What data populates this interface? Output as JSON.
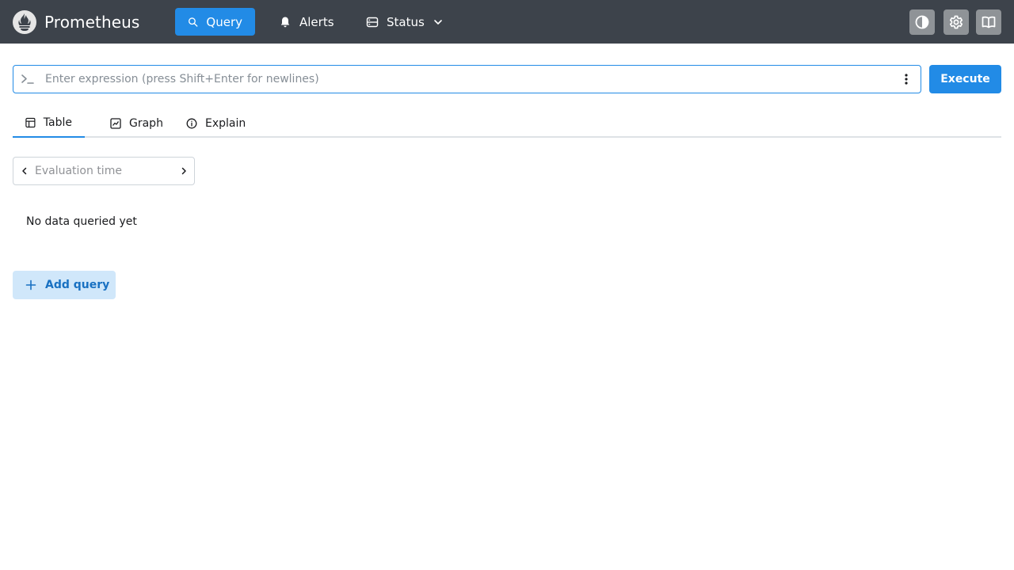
{
  "app": {
    "title": "Prometheus",
    "logo_icon": "prometheus-flame-logo"
  },
  "nav": {
    "query_label": "Query",
    "alerts_label": "Alerts",
    "status_label": "Status",
    "active": "Query"
  },
  "header_actions": {
    "theme_icon": "contrast-icon",
    "settings_icon": "gear-icon",
    "docs_icon": "book-icon"
  },
  "expression": {
    "placeholder": "Enter expression (press Shift+Enter for newlines)",
    "value": "",
    "execute_label": "Execute"
  },
  "tabs": {
    "table_label": "Table",
    "graph_label": "Graph",
    "explain_label": "Explain",
    "active": "Table"
  },
  "evaluation": {
    "placeholder": "Evaluation time",
    "value": ""
  },
  "results": {
    "empty_message": "No data queried yet"
  },
  "add_query": {
    "label": "Add query"
  },
  "colors": {
    "header_bg": "#3d434b",
    "accent": "#228be6",
    "add_query_bg": "#d0e7fa",
    "add_query_text": "#1971c2",
    "icon_button_bg": "#8f9397"
  }
}
